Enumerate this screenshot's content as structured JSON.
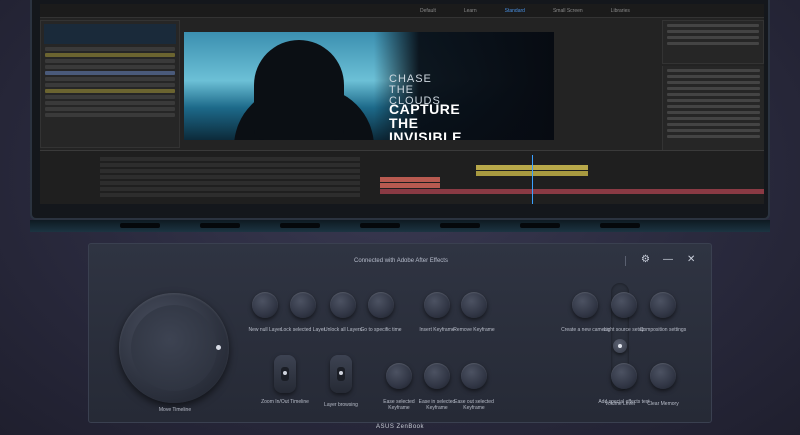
{
  "workspace_tabs": [
    "Default",
    "Learn",
    "Standard",
    "Small Screen",
    "Libraries"
  ],
  "viewer": {
    "line1": "CHASE",
    "line2": "THE",
    "line3": "CLOUDS",
    "line4": "CAPTURE",
    "line5": "THE",
    "line6": "INVISIBLE"
  },
  "control_panel": {
    "title": "Connected with Adobe After Effects",
    "dial_label": "Move Timeline",
    "buttons": [
      {
        "label": "New null Layer"
      },
      {
        "label": "Lock selected Layer"
      },
      {
        "label": "Unlock all Layers"
      },
      {
        "label": "Go to specific time"
      },
      {
        "label": "Insert Keyframe"
      },
      {
        "label": "Remove Keyframe"
      },
      {
        "label": "Create a new camera"
      },
      {
        "label": "Light source setup"
      },
      {
        "label": "Composition settings"
      },
      {
        "label": "Ease selected Keyframe"
      },
      {
        "label": "Ease in selected Keyframe"
      },
      {
        "label": "Ease out selected Keyframe"
      },
      {
        "label": "Add special effects text"
      },
      {
        "label": "Clear Memory"
      }
    ],
    "toggles": [
      {
        "label": "Zoom In/Out Timeline"
      },
      {
        "label": "Layer browsing"
      }
    ],
    "slider": {
      "label": "Volume Level",
      "level": 0.4
    }
  },
  "brand": "ASUS ZenBook"
}
